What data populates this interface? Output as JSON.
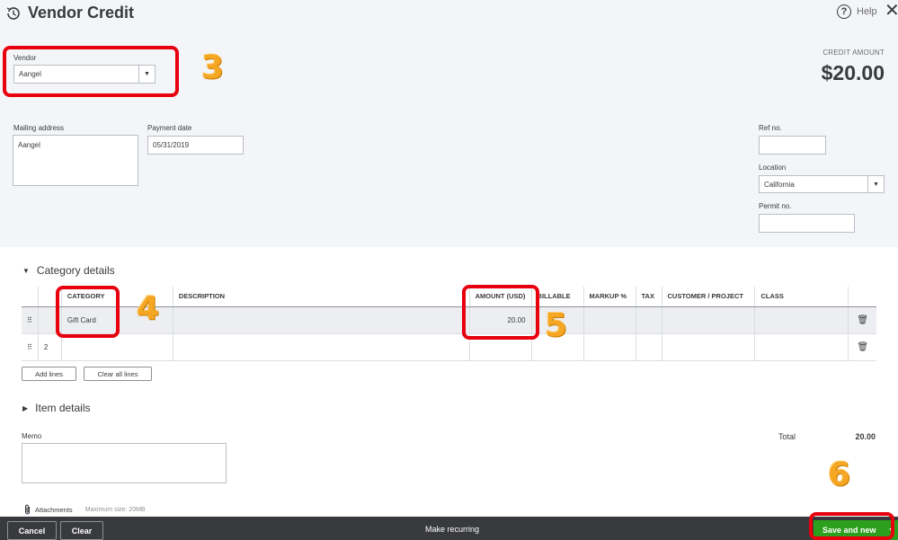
{
  "header": {
    "title": "Vendor Credit",
    "help_label": "Help"
  },
  "vendor": {
    "label": "Vendor",
    "value": "Aangel"
  },
  "credit": {
    "label": "CREDIT AMOUNT",
    "amount": "$20.00"
  },
  "mailing": {
    "label": "Mailing address",
    "value": "Aangel"
  },
  "payment_date": {
    "label": "Payment date",
    "value": "05/31/2019"
  },
  "ref": {
    "label": "Ref no.",
    "value": ""
  },
  "location": {
    "label": "Location",
    "value": "California"
  },
  "permit": {
    "label": "Permit no.",
    "value": ""
  },
  "category_details": {
    "title": "Category details",
    "headers": {
      "category": "CATEGORY",
      "description": "DESCRIPTION",
      "amount": "AMOUNT (USD)",
      "billable": "BILLABLE",
      "markup": "MARKUP %",
      "tax": "TAX",
      "customer": "CUSTOMER / PROJECT",
      "class": "CLASS"
    },
    "rows": [
      {
        "index": "",
        "category": "Gift Card",
        "description": "",
        "amount": "20.00"
      },
      {
        "index": "2",
        "category": "",
        "description": "",
        "amount": ""
      }
    ],
    "add_lines": "Add lines",
    "clear_all": "Clear all lines"
  },
  "item_details": {
    "title": "Item details"
  },
  "memo": {
    "label": "Memo",
    "value": ""
  },
  "total": {
    "label": "Total",
    "value": "20.00"
  },
  "attachments": {
    "label": "Attachments",
    "max": "Maximum size: 20MB"
  },
  "footer": {
    "cancel": "Cancel",
    "clear": "Clear",
    "recurring": "Make recurring",
    "save_new": "Save and new"
  },
  "annotations": {
    "step3": "3",
    "step4": "4",
    "step5": "5",
    "step6": "6"
  },
  "colors": {
    "annotation_box": "#e8000e",
    "annotation_number": "#f5a623",
    "primary_button": "#2ca01c",
    "footer_bg": "#393a3d",
    "header_bg": "#f4f5f8"
  },
  "icons": [
    "history-icon",
    "help-icon",
    "close-icon",
    "dropdown-arrow-icon",
    "collapse-triangle-icon",
    "expand-triangle-icon",
    "drag-handle-icon",
    "trash-icon",
    "paperclip-icon"
  ]
}
